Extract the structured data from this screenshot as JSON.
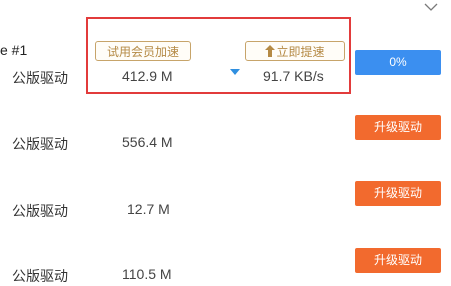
{
  "rows": [
    {
      "name": "e #1",
      "category": "公版驱动",
      "size": "412.9 M",
      "speed": "91.7 KB/s",
      "trial_label": "试用会员加速",
      "boost_label": "立即提速",
      "progress_label": "0%",
      "progress": 0
    },
    {
      "category": "公版驱动",
      "size": "556.4 M",
      "action_label": "升级驱动"
    },
    {
      "category": "公版驱动",
      "size": "12.7 M",
      "action_label": "升级驱动"
    },
    {
      "category": "公版驱动",
      "size": "110.5 M",
      "action_label": "升级驱动"
    }
  ],
  "colors": {
    "highlight_border": "#e23b3b",
    "progress_blue": "#3b8ff0",
    "upgrade_orange": "#f26a2e",
    "pill_gold": "#c7a46a"
  },
  "icons": [
    "chevron-down-icon",
    "arrow-up-icon",
    "dropdown-marker-icon"
  ]
}
